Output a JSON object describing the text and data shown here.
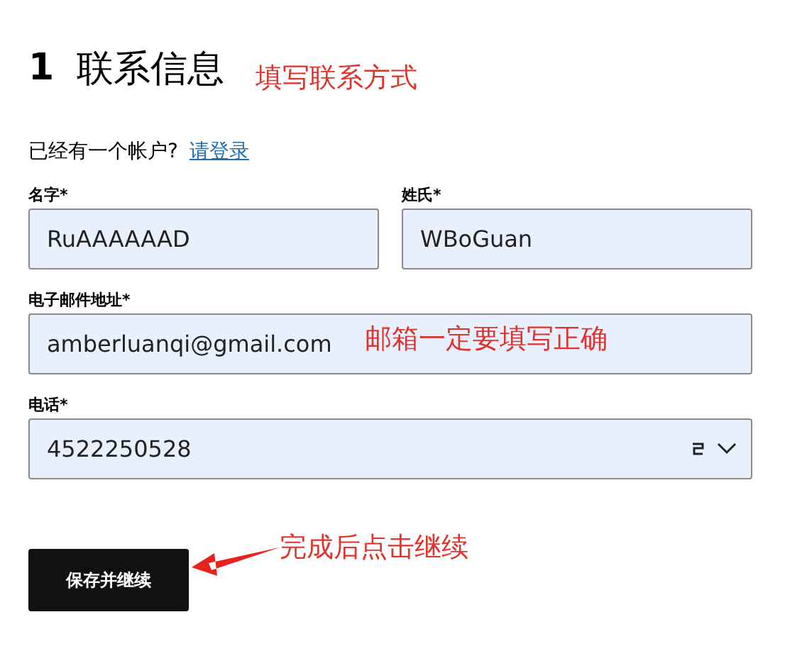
{
  "heading": {
    "number": "1",
    "title": "联系信息",
    "note": "填写联系方式"
  },
  "account_prompt": {
    "text": "已经有一个帐户?",
    "link": "请登录"
  },
  "fields": [
    {
      "kind": "half",
      "label": "名字*",
      "value": "RuAAAAAAD"
    },
    {
      "kind": "half",
      "label": "姓氏*",
      "value": "WBoGuan"
    },
    {
      "kind": "full",
      "label": "电子邮件地址*",
      "value": "amberluanqi@gmail.com",
      "note": "邮箱一定要填写正确"
    },
    {
      "kind": "phone",
      "label": "电话*",
      "value": "4522250528"
    }
  ],
  "button": {
    "label": "保存并继续",
    "note": "完成后点击继续"
  }
}
